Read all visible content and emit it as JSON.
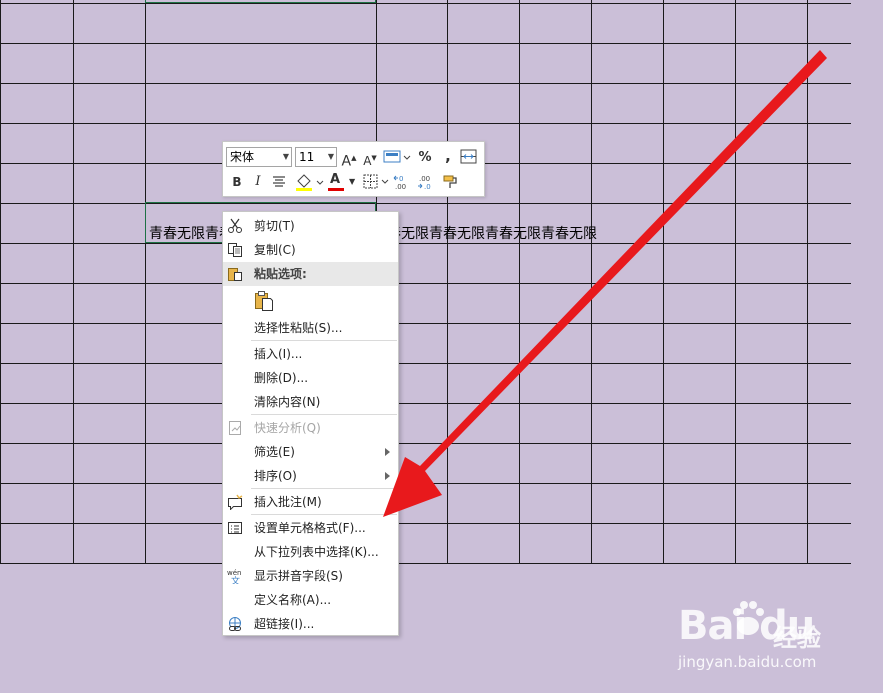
{
  "sheet": {
    "cell_text": "青春无限青春无限青春无限青春无限青春无限青春无限青春无限青春无限"
  },
  "mini_toolbar": {
    "font_name": "宋体",
    "font_size": "11",
    "increase_font": "A",
    "decrease_font": "A",
    "percent": "%",
    "comma": ",",
    "bold": "B",
    "italic": "I",
    "font_color": "A",
    "font_color_value": "#e00000"
  },
  "context_menu": {
    "items": [
      {
        "label": "剪切(T)",
        "icon": "scissors-icon"
      },
      {
        "label": "复制(C)",
        "icon": "copy-icon"
      },
      {
        "label": "粘贴选项:",
        "icon": "paste-icon"
      },
      {
        "label": "选择性粘贴(S)...",
        "icon": ""
      },
      {
        "label": "插入(I)...",
        "icon": ""
      },
      {
        "label": "删除(D)...",
        "icon": ""
      },
      {
        "label": "清除内容(N)",
        "icon": ""
      },
      {
        "label": "快速分析(Q)",
        "icon": "quick-analysis-icon",
        "disabled": true
      },
      {
        "label": "筛选(E)",
        "icon": "",
        "submenu": true
      },
      {
        "label": "排序(O)",
        "icon": "",
        "submenu": true
      },
      {
        "label": "插入批注(M)",
        "icon": "comment-icon"
      },
      {
        "label": "设置单元格格式(F)...",
        "icon": "format-cells-icon"
      },
      {
        "label": "从下拉列表中选择(K)...",
        "icon": ""
      },
      {
        "label": "显示拼音字段(S)",
        "icon": "phonetic-icon"
      },
      {
        "label": "定义名称(A)...",
        "icon": ""
      },
      {
        "label": "超链接(I)...",
        "icon": "hyperlink-icon"
      }
    ]
  },
  "watermark": {
    "logo": "Bai du",
    "brand_cn": "经验",
    "url": "jingyan.baidu.com"
  },
  "colors": {
    "cell_fill": "#cbbfd8",
    "arrow": "#e8191c"
  }
}
